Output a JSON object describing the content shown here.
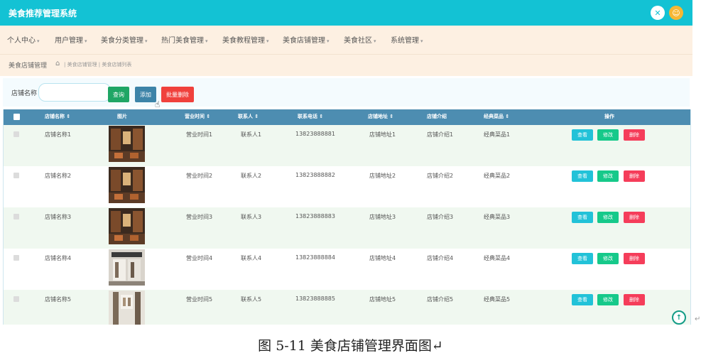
{
  "app": {
    "title": "美食推荐管理系统"
  },
  "topbar": {
    "settings_icon": "settings-icon",
    "avatar_icon": "avatar-icon"
  },
  "nav": {
    "items": [
      {
        "label": "个人中心",
        "has_caret": true
      },
      {
        "label": "用户管理",
        "has_caret": true
      },
      {
        "label": "美食分类管理",
        "has_caret": true
      },
      {
        "label": "热门美食管理",
        "has_caret": true
      },
      {
        "label": "美食教程管理",
        "has_caret": true
      },
      {
        "label": "美食店铺管理",
        "has_caret": true
      },
      {
        "label": "美食社区",
        "has_caret": true
      },
      {
        "label": "系统管理",
        "has_caret": true
      }
    ],
    "caret": "▾"
  },
  "breadcrumb": {
    "title": "美食店铺管理",
    "home_icon": "⌂",
    "path": "| 美食店铺管理 | 美食店铺列表"
  },
  "search": {
    "label": "店铺名称",
    "value": "",
    "placeholder": "",
    "search_button": "查询",
    "add_button": "添加",
    "batch_delete_button": "批量删除"
  },
  "table": {
    "columns": [
      "店铺名称 ⇕",
      "图片",
      "营业时间 ⇕",
      "联系人 ⇕",
      "联系电话 ⇕",
      "店铺地址 ⇕",
      "店铺介绍",
      "经典菜品 ⇕",
      "操作"
    ],
    "rows": [
      {
        "name": "店铺名称1",
        "hours": "营业时间1",
        "contact": "联系人1",
        "phone": "13823888881",
        "address": "店铺地址1",
        "intro": "店铺介绍1",
        "dish": "经典菜品1"
      },
      {
        "name": "店铺名称2",
        "hours": "营业时间2",
        "contact": "联系人2",
        "phone": "13823888882",
        "address": "店铺地址2",
        "intro": "店铺介绍2",
        "dish": "经典菜品2"
      },
      {
        "name": "店铺名称3",
        "hours": "营业时间3",
        "contact": "联系人3",
        "phone": "13823888883",
        "address": "店铺地址3",
        "intro": "店铺介绍3",
        "dish": "经典菜品3"
      },
      {
        "name": "店铺名称4",
        "hours": "营业时间4",
        "contact": "联系人4",
        "phone": "13823888884",
        "address": "店铺地址4",
        "intro": "店铺介绍4",
        "dish": "经典菜品4"
      },
      {
        "name": "店铺名称5",
        "hours": "营业时间5",
        "contact": "联系人5",
        "phone": "13823888885",
        "address": "店铺地址5",
        "intro": "店铺介绍5",
        "dish": "经典菜品5"
      }
    ],
    "actions": {
      "view": "查看",
      "edit": "修改",
      "delete": "删除"
    }
  },
  "scroll_top_icon": "↑",
  "return_mark": "↵",
  "caption": "图 5-11 美食店铺管理界面图↵",
  "colors": {
    "topbar": "#13c2d4",
    "nav_bg": "#fdf0e2",
    "table_header": "#4d8db1",
    "search_btn": "#1fa665",
    "add_btn": "#3d84a8",
    "delete_btn": "#f0413c"
  }
}
